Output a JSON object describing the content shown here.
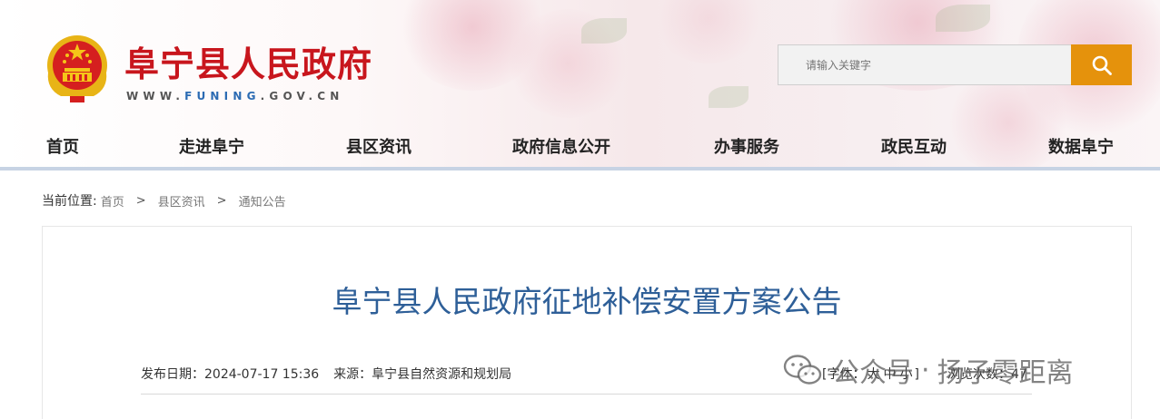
{
  "header": {
    "site_title": "阜宁县人民政府",
    "site_url_pre": "WWW.",
    "site_url_hl": "FUNING",
    "site_url_post": ".GOV.CN",
    "emblem_icon": "national-emblem-icon"
  },
  "search": {
    "placeholder": "请输入关键字",
    "button_icon": "search-icon",
    "button_color": "#e5920c"
  },
  "nav": {
    "items": [
      "首页",
      "走进阜宁",
      "县区资讯",
      "政府信息公开",
      "办事服务",
      "政民互动",
      "数据阜宁"
    ]
  },
  "breadcrumb": {
    "label": "当前位置:",
    "items": [
      "首页",
      "县区资讯",
      "通知公告"
    ],
    "separator": ">"
  },
  "article": {
    "title": "阜宁县人民政府征地补偿安置方案公告",
    "publish_date": "发布日期：2024-07-17 15:36",
    "source": "来源：阜宁县自然资源和规划局",
    "font_prefix": "[字体：",
    "font_large": "大",
    "font_medium": "中",
    "font_small": "小",
    "font_suffix": "]",
    "views": "浏览次数：47"
  },
  "watermark": {
    "icon": "wechat-icon",
    "text_a": "公众号",
    "dot": "·",
    "text_b": "扬子零距离"
  },
  "colors": {
    "brand_red": "#c8161d",
    "title_blue": "#2e5f98",
    "nav_rule": "#c7d3e4"
  }
}
